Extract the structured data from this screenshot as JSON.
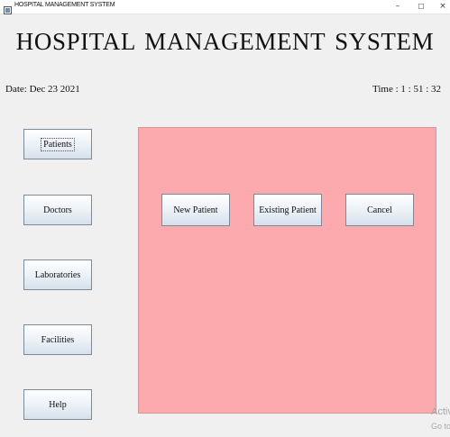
{
  "window": {
    "title": "HOSPITAL MANAGEMENT SYSTEM",
    "minimize_glyph": "–",
    "maximize_glyph": "☐",
    "close_glyph": "×"
  },
  "header": {
    "title": "HOSPITAL MANAGEMENT SYSTEM",
    "date": "Date: Dec 23 2021",
    "time": "Time : 1 : 51 : 32"
  },
  "sidebar": {
    "items": [
      {
        "label": "Patients"
      },
      {
        "label": "Doctors"
      },
      {
        "label": "Laboratories"
      },
      {
        "label": "Facilities"
      },
      {
        "label": "Help"
      }
    ]
  },
  "panel": {
    "background_color": "#fdaaae",
    "buttons": [
      {
        "label": "New Patient"
      },
      {
        "label": "Existing Patient"
      },
      {
        "label": "Cancel"
      }
    ]
  },
  "watermark": {
    "line1": "Activ",
    "line2": "Go to"
  }
}
